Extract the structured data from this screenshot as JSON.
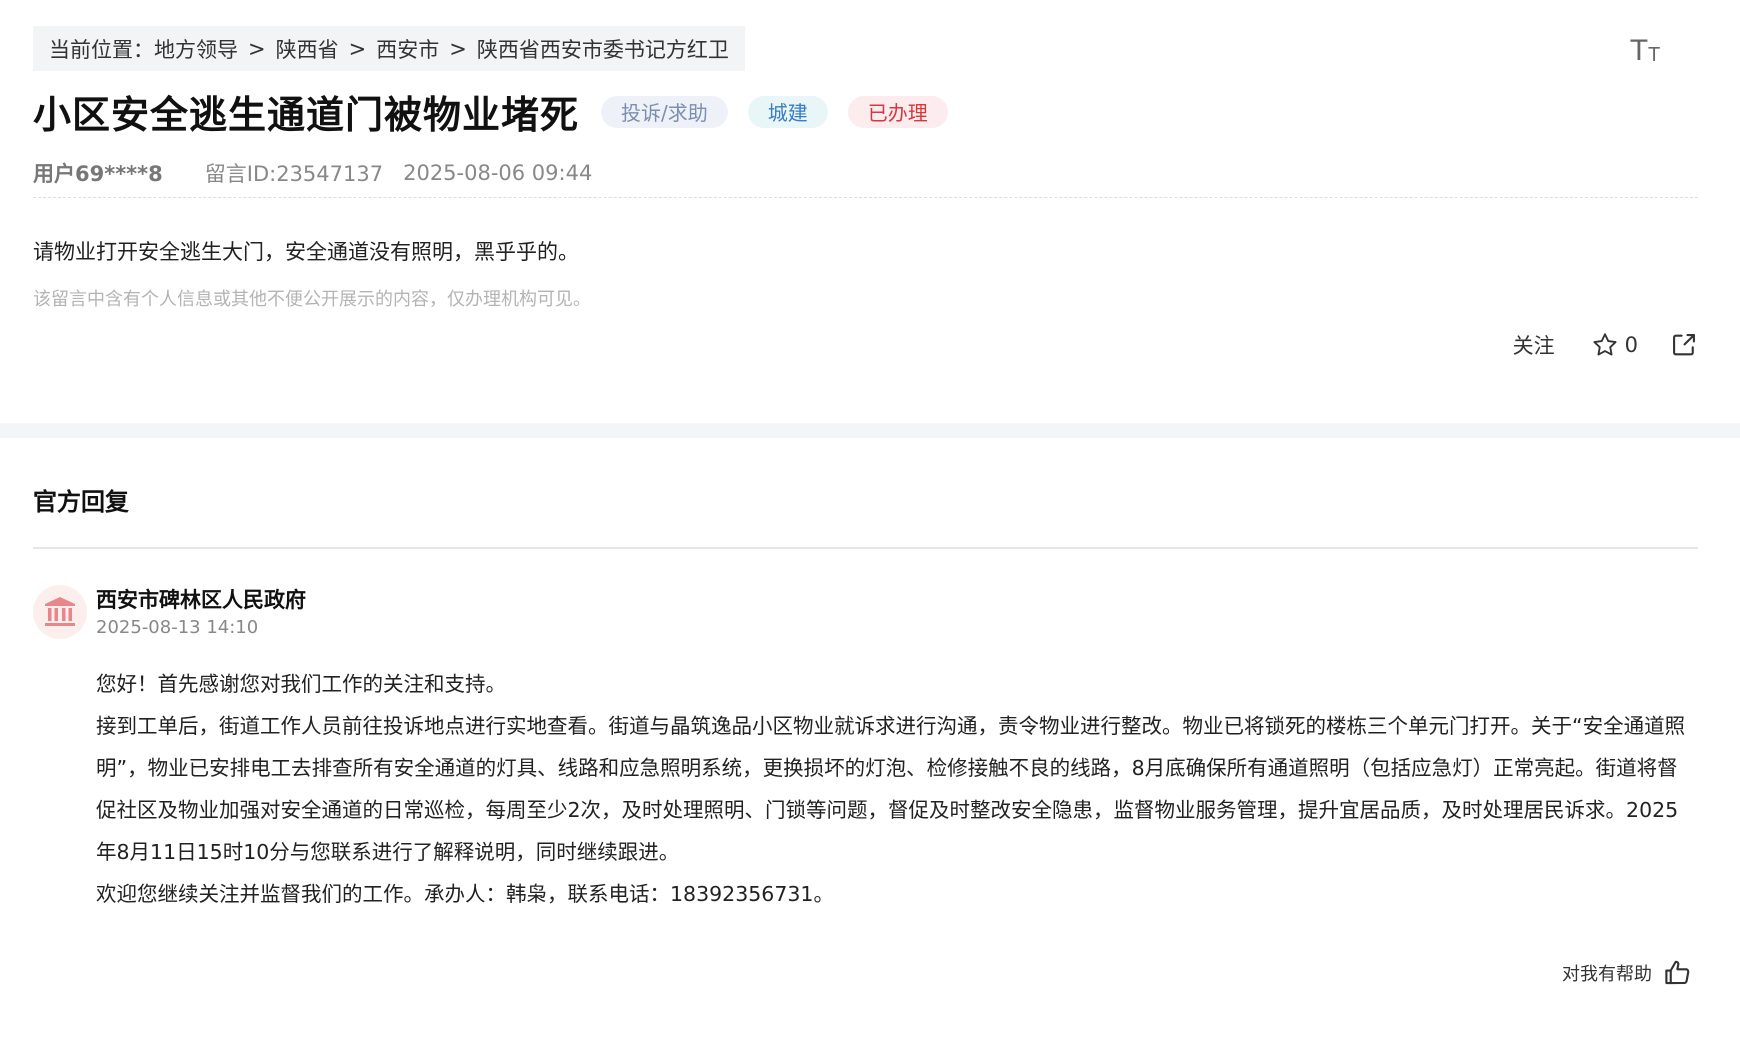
{
  "breadcrumb": {
    "prefix": "当前位置：",
    "items": [
      "地方领导",
      "陕西省",
      "西安市",
      "陕西省西安市委书记方红卫"
    ],
    "separator": ">"
  },
  "font_size_button": {
    "big": "T",
    "small": "T"
  },
  "post": {
    "title": "小区安全逃生通道门被物业堵死",
    "tags": {
      "type": "投诉/求助",
      "category": "城建",
      "status": "已办理"
    },
    "user": "用户69****8",
    "message_id": "留言ID:23547137",
    "time": "2025-08-06 09:44",
    "content": "请物业打开安全逃生大门，安全通道没有照明，黑乎乎的。",
    "privacy_notice": "该留言中含有个人信息或其他不便公开展示的内容，仅办理机构可见。"
  },
  "actions": {
    "follow_label": "关注",
    "star_count": "0"
  },
  "reply": {
    "heading": "官方回复",
    "org_name": "西安市碑林区人民政府",
    "time": "2025-08-13 14:10",
    "paragraphs": [
      "您好！首先感谢您对我们工作的关注和支持。",
      "接到工单后，街道工作人员前往投诉地点进行实地查看。街道与晶筑逸品小区物业就诉求进行沟通，责令物业进行整改。物业已将锁死的楼栋三个单元门打开。关于“安全通道照明”，物业已安排电工去排查所有安全通道的灯具、线路和应急照明系统，更换损坏的灯泡、检修接触不良的线路，8月底确保所有通道照明（包括应急灯）正常亮起。街道将督促社区及物业加强对安全通道的日常巡检，每周至少2次，及时处理照明、门锁等问题，督促及时整改安全隐患，监督物业服务管理，提升宜居品质，及时处理居民诉求。2025年8月11日15时10分与您联系进行了解释说明，同时继续跟进。",
      "欢迎您继续关注并监督我们的工作。承办人：韩枭，联系电话：18392356731。"
    ],
    "helpful_label": "对我有帮助"
  },
  "colors": {
    "status_red": "#d9363e",
    "category_blue": "#3a7cc4",
    "type_gray": "#7d8fae",
    "avatar_red": "#e8878a"
  },
  "icons": {
    "font_size": "font-size-icon",
    "star": "star-icon",
    "share": "share-icon",
    "org": "government-building-icon",
    "thumbs_up": "thumbs-up-icon"
  }
}
